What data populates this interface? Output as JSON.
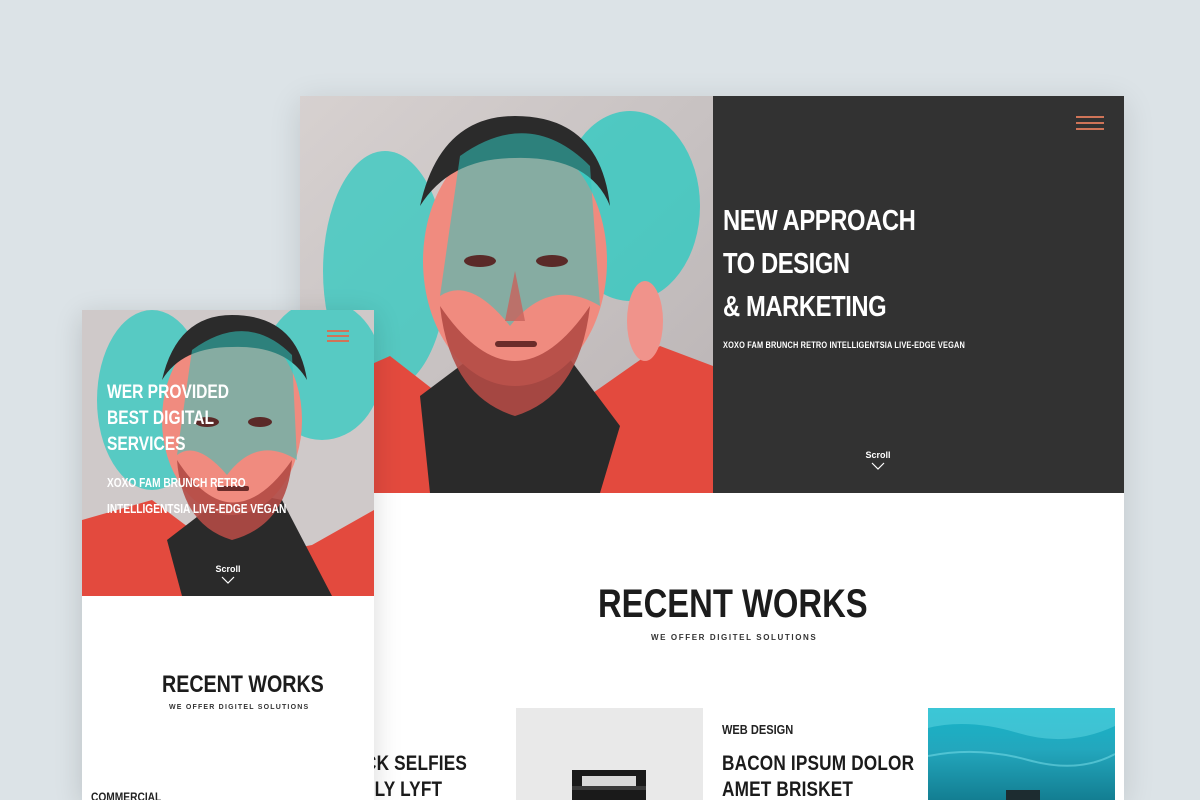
{
  "desktop": {
    "hero": {
      "title_lines": [
        "NEW APPROACH",
        "TO DESIGN",
        "& MARKETING"
      ],
      "subtitle": "XOXO FAM BRUNCH RETRO INTELLIGENTSIA LIVE-EDGE VEGAN",
      "scroll_label": "Scroll",
      "menu_icon": "hamburger-menu-icon"
    },
    "recent_works": {
      "title": "RECENT WORKS",
      "subtitle": "WE OFFER DIGITEL SOLUTIONS"
    },
    "posts": [
      {
        "title_lines": [
          "CK SELFIES",
          "LLY LYFT"
        ]
      },
      {
        "category": "WEB DESIGN",
        "title_lines": [
          "BACON IPSUM DOLOR",
          "AMET BRISKET"
        ]
      }
    ]
  },
  "mobile": {
    "hero": {
      "title_lines": [
        "WER PROVIDED",
        "BEST DIGITAL",
        "SERVICES"
      ],
      "subtitle_lines": [
        "XOXO FAM BRUNCH RETRO",
        "INTELLIGENTSIA LIVE-EDGE VEGAN"
      ],
      "scroll_label": "Scroll",
      "menu_icon": "hamburger-menu-icon"
    },
    "recent_works": {
      "title": "RECENT WORKS",
      "subtitle": "WE OFFER DIGITEL SOLUTIONS"
    },
    "category": "COMMERCIAL"
  },
  "colors": {
    "background": "#dce3e7",
    "dark_panel": "#323232",
    "accent": "#d07458",
    "duotone_red": "#e8473f",
    "duotone_cyan": "#2fc9c0"
  }
}
